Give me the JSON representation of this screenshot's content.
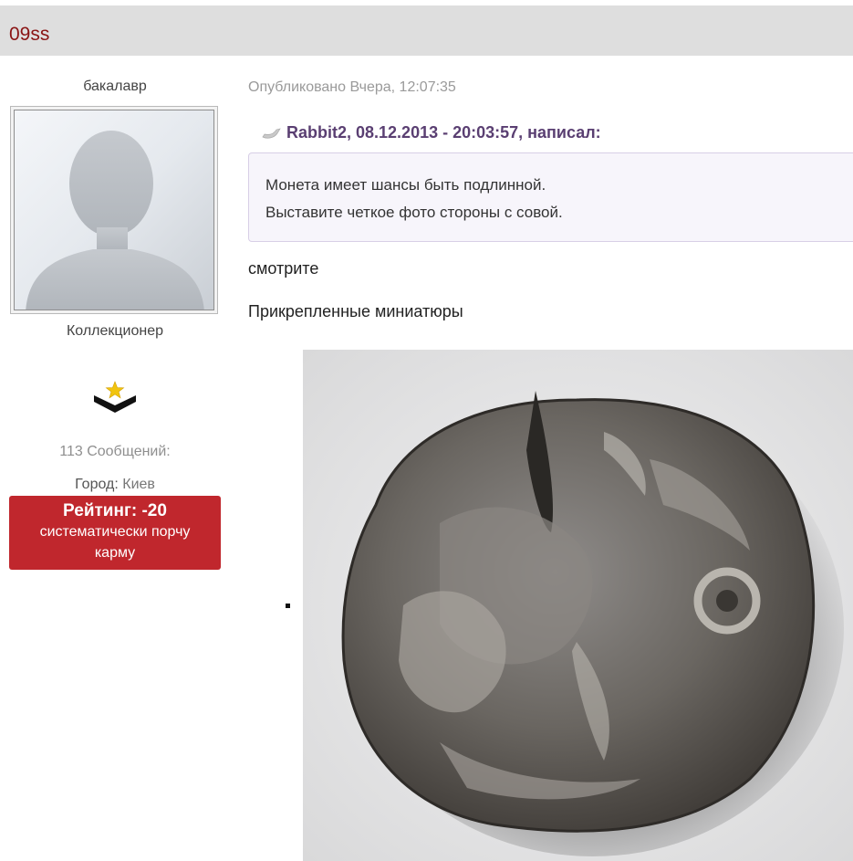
{
  "header": {
    "username": "09ss"
  },
  "sidebar": {
    "user_title": "бакалавр",
    "avatar_icon": "default-avatar-silhouette",
    "user_group": "Коллекционер",
    "rank_icon": "chevron-star-rank-icon",
    "post_count": "113 Сообщений:",
    "city_label": "Город:",
    "city_value": "Киев",
    "rating": {
      "title": "Рейтинг: -20",
      "subtitle": "систематически порчу карму",
      "color": "#c0272d"
    }
  },
  "post": {
    "published": "Опубликовано Вчера, 12:07:35",
    "quote": {
      "header": "Rabbit2, 08.12.2013 - 20:03:57, написал:",
      "lines": [
        "Монета имеет шансы быть подлинной.",
        "Выставите четкое фото стороны с совой."
      ]
    },
    "body_text": "смотрите",
    "attachments_label": "Прикрепленные миниатюры",
    "attachments": [
      {
        "icon": "coin-photo-thumbnail"
      }
    ]
  }
}
